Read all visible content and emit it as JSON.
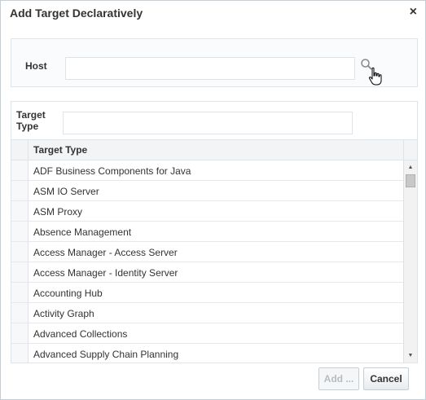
{
  "dialog": {
    "title": "Add Target Declaratively",
    "close_glyph": "×"
  },
  "host": {
    "label": "Host",
    "value": "",
    "search_icon": "search-icon"
  },
  "filter": {
    "label": "Target Type",
    "value": ""
  },
  "table": {
    "column_header": "Target Type",
    "rows": [
      "ADF Business Components for Java",
      "ASM IO Server",
      "ASM Proxy",
      "Absence Management",
      "Access Manager - Access Server",
      "Access Manager - Identity Server",
      "Accounting Hub",
      "Activity Graph",
      "Advanced Collections",
      "Advanced Supply Chain Planning"
    ]
  },
  "buttons": {
    "add_label": "Add ...",
    "cancel_label": "Cancel"
  },
  "colors": {
    "border": "#dfe4e8",
    "header_bg": "#f2f4f6",
    "disabled_text": "#b8bcc0"
  }
}
